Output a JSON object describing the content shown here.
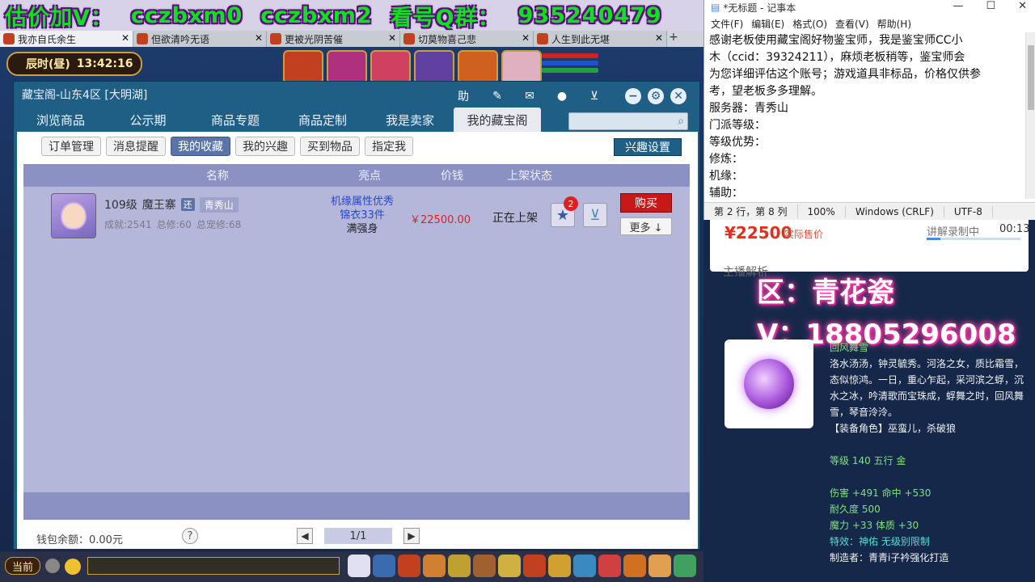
{
  "banner": {
    "text1": "估价加V：",
    "text2": "cczbxm0",
    "text3": "cczbxm2",
    "text4": "看号Q群：",
    "text5": "935240479"
  },
  "game_tabs": [
    {
      "label": "我亦自氏余生"
    },
    {
      "label": "但欲清吟无语"
    },
    {
      "label": "更被光阴苦催"
    },
    {
      "label": "切莫物喜己悲"
    },
    {
      "label": "人生到此无堪"
    }
  ],
  "clock": {
    "period": "辰时(昼)",
    "time": "13:42:16"
  },
  "window": {
    "title": "藏宝阁-山东4区 [大明湖]",
    "ctrl_help": "助",
    "nav": [
      {
        "label": "浏览商品"
      },
      {
        "label": "公示期"
      },
      {
        "label": "商品专题"
      },
      {
        "label": "商品定制"
      },
      {
        "label": "我是卖家"
      },
      {
        "label": "我的藏宝阁"
      }
    ],
    "subtabs": [
      {
        "label": "订单管理"
      },
      {
        "label": "消息提醒"
      },
      {
        "label": "我的收藏"
      },
      {
        "label": "我的兴趣"
      },
      {
        "label": "买到物品"
      },
      {
        "label": "指定我"
      }
    ],
    "pref_button": "兴趣设置",
    "columns": [
      "名称",
      "亮点",
      "价钱",
      "上架状态"
    ],
    "row": {
      "level": "109级",
      "school": "魔王寨",
      "tag": "还",
      "server": "青秀山",
      "achievement": "成就:2541",
      "total_cultivation": "总修:60",
      "total_pet_cultivation": "总宠修:68",
      "highlight1": "机缘属性优秀",
      "highlight2": "锦衣33件",
      "highlight3": "满强身",
      "price": "￥22500.00",
      "status": "正在上架",
      "fav_count": "2",
      "buy": "购买",
      "more": "更多 ↓"
    },
    "wallet": "钱包余额：0.00元",
    "help": "?",
    "page": "1/1"
  },
  "chat": {
    "current": "当前"
  },
  "notepad": {
    "title": "*无标题 - 记事本",
    "menu": [
      "文件(F)",
      "编辑(E)",
      "格式(O)",
      "查看(V)",
      "帮助(H)"
    ],
    "lines": [
      "感谢老板使用藏宝阁好物鉴宝师，我是鉴宝师CC小",
      "木（ccid：39324211），麻烦老板稍等，鉴宝师会",
      "为您详细评估这个账号；游戏道具非标品，价格仅供参",
      "考，望老板多多理解。",
      "服务器：青秀山",
      "门派等级：",
      "等级优势：",
      "修炼：",
      "机缘：",
      "辅助："
    ],
    "status": [
      "第 2 行，第 8 列",
      "100%",
      "Windows (CRLF)",
      "UTF-8"
    ]
  },
  "stream": {
    "price": "¥22500",
    "price_label": "实际售价",
    "recording": "讲解录制中",
    "time": "00:13",
    "progress": 0.15,
    "analysis": "主播解析",
    "overlay_region": "区：青花瓷",
    "overlay_v": "V：18805296008"
  },
  "item": {
    "name": "回风舞雪",
    "desc": "洛水汤汤，钟灵毓秀。河洛之女，质比霜雪，态似惊鸿。一日，重心乍起，采河滨之蜉，沉水之冰，吟清歌而宝珠成，蜉舞之时，回风舞雪，琴音泠泠。",
    "role": "【装备角色】巫蛮儿，杀破狼",
    "level": "等级 140 五行 金",
    "attack": "伤害 +491 命中 +530",
    "durability": "耐久度 500",
    "magic": "魔力 +33 体质 +30",
    "special": "特效：神佑 无级别限制",
    "maker": "制造者：青青i子衿强化打造"
  }
}
